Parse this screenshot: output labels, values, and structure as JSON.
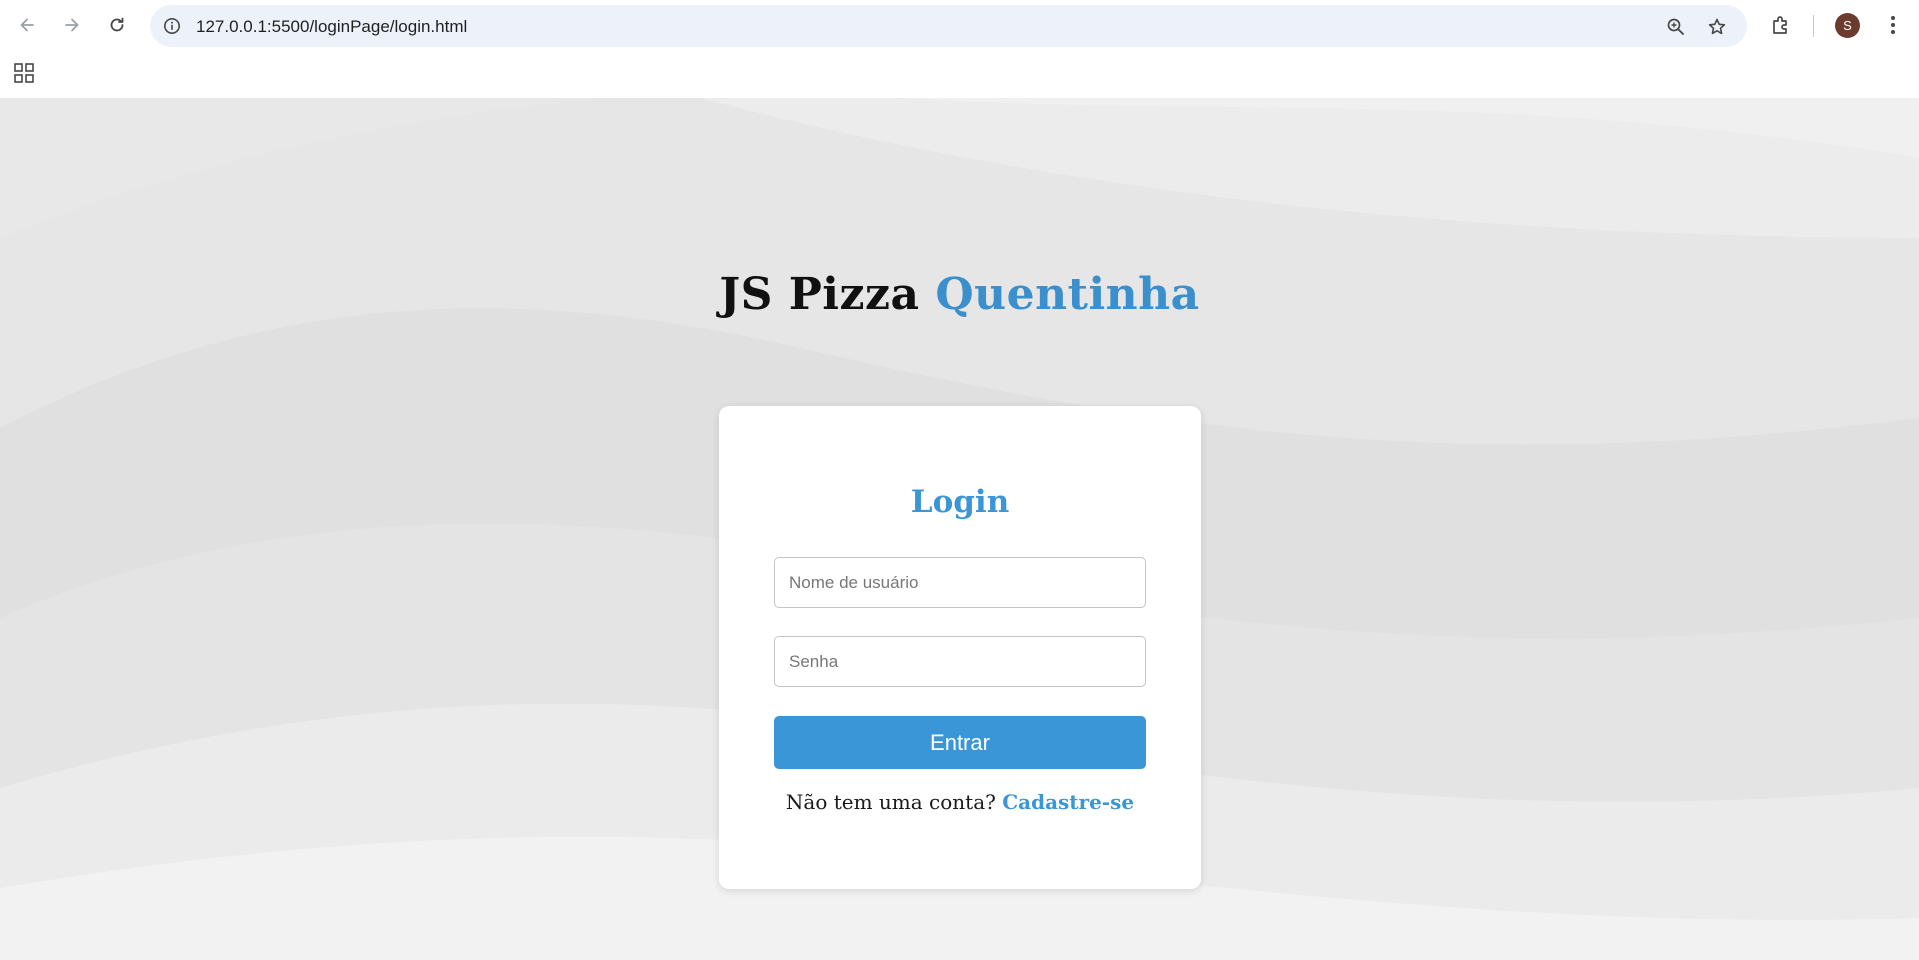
{
  "browser": {
    "url": "127.0.0.1:5500/loginPage/login.html",
    "profile_initial": "S",
    "icons": [
      "back-arrow-icon",
      "forward-arrow-icon",
      "reload-icon",
      "site-info-icon",
      "zoom-icon",
      "bookmark-star-icon",
      "extensions-icon",
      "menu-dots-icon",
      "apps-grid-icon"
    ]
  },
  "page": {
    "headline_main": "JS Pizza",
    "headline_accent": "Quentinha",
    "login": {
      "title": "Login",
      "username_placeholder": "Nome de usuário",
      "password_placeholder": "Senha",
      "submit_label": "Entrar",
      "signup_prompt": "Não tem uma conta?",
      "signup_link": "Cadastre-se"
    }
  },
  "colors": {
    "accent": "#3a96d6",
    "headline_accent": "#3a8fcc",
    "background": "#e6e6e6",
    "card": "#ffffff"
  }
}
